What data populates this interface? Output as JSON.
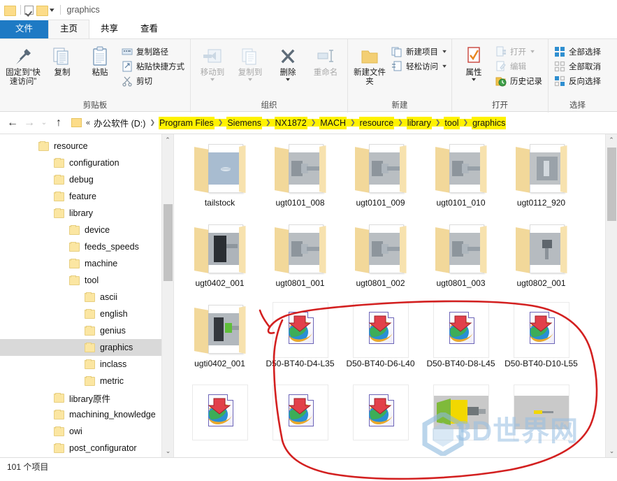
{
  "window": {
    "title": "graphics",
    "titlebar_icons": [
      "folder-icon",
      "properties-checkbox-icon",
      "folder-icon",
      "customize-quick-access-caret-icon"
    ]
  },
  "ribbon": {
    "tabs": [
      {
        "label": "文件",
        "id": "file",
        "state": "file"
      },
      {
        "label": "主页",
        "id": "home",
        "state": "active"
      },
      {
        "label": "共享",
        "id": "share",
        "state": "normal"
      },
      {
        "label": "查看",
        "id": "view",
        "state": "normal"
      }
    ],
    "groups": [
      {
        "label": "剪贴板",
        "big": [
          {
            "label": "固定到“快速访问”",
            "icon": "pin-icon",
            "dim": false
          },
          {
            "label": "复制",
            "icon": "copy-icon",
            "dim": false
          },
          {
            "label": "粘贴",
            "icon": "paste-icon",
            "dim": false
          }
        ],
        "small": [
          {
            "label": "复制路径",
            "icon": "copy-path-icon",
            "dim": false
          },
          {
            "label": "粘贴快捷方式",
            "icon": "paste-shortcut-icon",
            "dim": false
          },
          {
            "label": "剪切",
            "icon": "scissors-icon",
            "dim": false
          }
        ]
      },
      {
        "label": "组织",
        "big": [
          {
            "label": "移动到",
            "icon": "move-to-icon",
            "dim": true,
            "caret": true
          },
          {
            "label": "复制到",
            "icon": "copy-to-icon",
            "dim": true,
            "caret": true
          },
          {
            "label": "删除",
            "icon": "delete-x-icon",
            "dim": false,
            "caret": true
          },
          {
            "label": "重命名",
            "icon": "rename-icon",
            "dim": true,
            "caret": false
          }
        ]
      },
      {
        "label": "新建",
        "big": [
          {
            "label": "新建文件夹",
            "icon": "new-folder-icon",
            "dim": false
          }
        ],
        "small": [
          {
            "label": "新建项目",
            "icon": "new-item-icon",
            "dropdown": true
          },
          {
            "label": "轻松访问",
            "icon": "easy-access-icon",
            "dropdown": true
          }
        ]
      },
      {
        "label": "打开",
        "big": [
          {
            "label": "属性",
            "icon": "properties-icon",
            "dim": false,
            "caret": true
          }
        ],
        "small": [
          {
            "label": "打开",
            "icon": "open-icon",
            "dim": true,
            "dropdown": true
          },
          {
            "label": "编辑",
            "icon": "edit-icon",
            "dim": true
          },
          {
            "label": "历史记录",
            "icon": "history-icon",
            "dim": false
          }
        ]
      },
      {
        "label": "选择",
        "small": [
          {
            "label": "全部选择",
            "icon": "select-all-icon",
            "dim": false
          },
          {
            "label": "全部取消",
            "icon": "select-none-icon",
            "dim": false
          },
          {
            "label": "反向选择",
            "icon": "invert-selection-icon",
            "dim": false
          }
        ]
      }
    ]
  },
  "navigation": {
    "back_icon": "arrow-left-icon",
    "forward_icon": "arrow-right-icon",
    "recent_icon": "chevron-down-icon",
    "up_icon": "arrow-up-icon",
    "overflow": "«",
    "breadcrumbs": [
      {
        "label": "办公软件 (D:)",
        "highlighted": false
      },
      {
        "label": "Program Files",
        "highlighted": true
      },
      {
        "label": "Siemens",
        "highlighted": true
      },
      {
        "label": "NX1872",
        "highlighted": true
      },
      {
        "label": "MACH",
        "highlighted": true
      },
      {
        "label": "resource",
        "highlighted": true
      },
      {
        "label": "library",
        "highlighted": true
      },
      {
        "label": "tool",
        "highlighted": true
      },
      {
        "label": "graphics",
        "highlighted": true
      }
    ],
    "highlight_color": "#fff200"
  },
  "tree": {
    "items": [
      {
        "label": "resource",
        "indent": 1,
        "selected": false
      },
      {
        "label": "configuration",
        "indent": 2,
        "selected": false
      },
      {
        "label": "debug",
        "indent": 2,
        "selected": false
      },
      {
        "label": "feature",
        "indent": 2,
        "selected": false
      },
      {
        "label": "library",
        "indent": 2,
        "selected": false
      },
      {
        "label": "device",
        "indent": 3,
        "selected": false
      },
      {
        "label": "feeds_speeds",
        "indent": 3,
        "selected": false
      },
      {
        "label": "machine",
        "indent": 3,
        "selected": false
      },
      {
        "label": "tool",
        "indent": 3,
        "selected": false
      },
      {
        "label": "ascii",
        "indent": 4,
        "selected": false
      },
      {
        "label": "english",
        "indent": 4,
        "selected": false
      },
      {
        "label": "genius",
        "indent": 4,
        "selected": false
      },
      {
        "label": "graphics",
        "indent": 4,
        "selected": true
      },
      {
        "label": "inclass",
        "indent": 4,
        "selected": false
      },
      {
        "label": "metric",
        "indent": 4,
        "selected": false
      },
      {
        "label": "library原件",
        "indent": 2,
        "selected": false
      },
      {
        "label": "machining_knowledge",
        "indent": 2,
        "selected": false
      },
      {
        "label": "owi",
        "indent": 2,
        "selected": false
      },
      {
        "label": "post_configurator",
        "indent": 2,
        "selected": false
      }
    ],
    "selected_bg": "#d9d9d9"
  },
  "files": {
    "items": [
      {
        "name": "tailstock",
        "kind": "folder",
        "thumb": "tailstock-preview"
      },
      {
        "name": "ugt0101_008",
        "kind": "folder",
        "thumb": "chuck-preview"
      },
      {
        "name": "ugt0101_009",
        "kind": "folder",
        "thumb": "chuck-preview"
      },
      {
        "name": "ugt0101_010",
        "kind": "folder",
        "thumb": "chuck-preview"
      },
      {
        "name": "ugt0112_920",
        "kind": "folder",
        "thumb": "block-preview"
      },
      {
        "name": "ugt0402_001",
        "kind": "folder",
        "thumb": "dark-tool-preview"
      },
      {
        "name": "ugt0801_001",
        "kind": "folder",
        "thumb": "chuck-preview"
      },
      {
        "name": "ugt0801_002",
        "kind": "folder",
        "thumb": "chuck-preview"
      },
      {
        "name": "ugt0801_003",
        "kind": "folder",
        "thumb": "chuck-preview"
      },
      {
        "name": "ugt0802_001",
        "kind": "folder",
        "thumb": "small-tool-preview"
      },
      {
        "name": "ugti0402_001",
        "kind": "folder",
        "thumb": "green-tool-preview"
      },
      {
        "name": "D50-BT40-D4-L35",
        "kind": "internet-shortcut"
      },
      {
        "name": "D50-BT40-D6-L40",
        "kind": "internet-shortcut"
      },
      {
        "name": "D50-BT40-D8-L45",
        "kind": "internet-shortcut"
      },
      {
        "name": "D50-BT40-D10-L55",
        "kind": "internet-shortcut"
      },
      {
        "name": "",
        "kind": "internet-shortcut"
      },
      {
        "name": "",
        "kind": "internet-shortcut"
      },
      {
        "name": "",
        "kind": "internet-shortcut"
      },
      {
        "name": "",
        "kind": "tool-thumb-yellow"
      },
      {
        "name": "",
        "kind": "tool-thumb-small"
      }
    ]
  },
  "statusbar": {
    "item_count": "101 个项目"
  },
  "watermark": {
    "text": "3D世界网",
    "logo": "hexagon-logo-icon"
  },
  "annotation": {
    "color": "#d32020",
    "shape": "hand-drawn-ellipse"
  }
}
